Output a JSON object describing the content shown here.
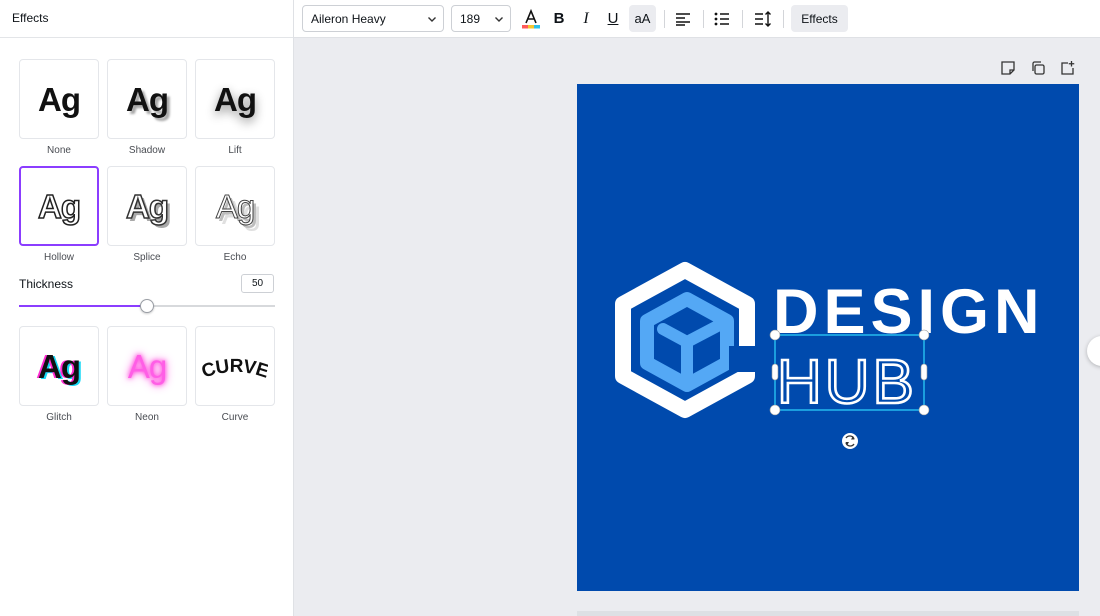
{
  "panel": {
    "title": "Effects",
    "effects_row1": [
      {
        "label": "None",
        "sample": "Ag"
      },
      {
        "label": "Shadow",
        "sample": "Ag"
      },
      {
        "label": "Lift",
        "sample": "Ag"
      }
    ],
    "effects_row2": [
      {
        "label": "Hollow",
        "sample": "Ag",
        "selected": true
      },
      {
        "label": "Splice",
        "sample": "Ag"
      },
      {
        "label": "Echo",
        "sample": "Ag"
      }
    ],
    "effects_row3": [
      {
        "label": "Glitch",
        "sample": "Ag"
      },
      {
        "label": "Neon",
        "sample": "Ag"
      },
      {
        "label": "Curve",
        "sample": "CURVE"
      }
    ],
    "thickness": {
      "label": "Thickness",
      "value": "50",
      "max": 100
    }
  },
  "toolbar": {
    "font": "Aileron Heavy",
    "size": "189",
    "bold": "B",
    "italic": "I",
    "underline": "U",
    "case": "aA",
    "effects": "Effects",
    "icons": [
      "text-color-icon",
      "align-left-icon",
      "list-icon",
      "spacing-icon"
    ]
  },
  "design": {
    "line1": "DESIGN",
    "line2": "HUB",
    "background": "#004aad",
    "accent": "#54a8f5",
    "selection_color": "#27c3f3"
  },
  "page_actions": [
    "note-icon",
    "duplicate-icon",
    "add-page-icon"
  ]
}
